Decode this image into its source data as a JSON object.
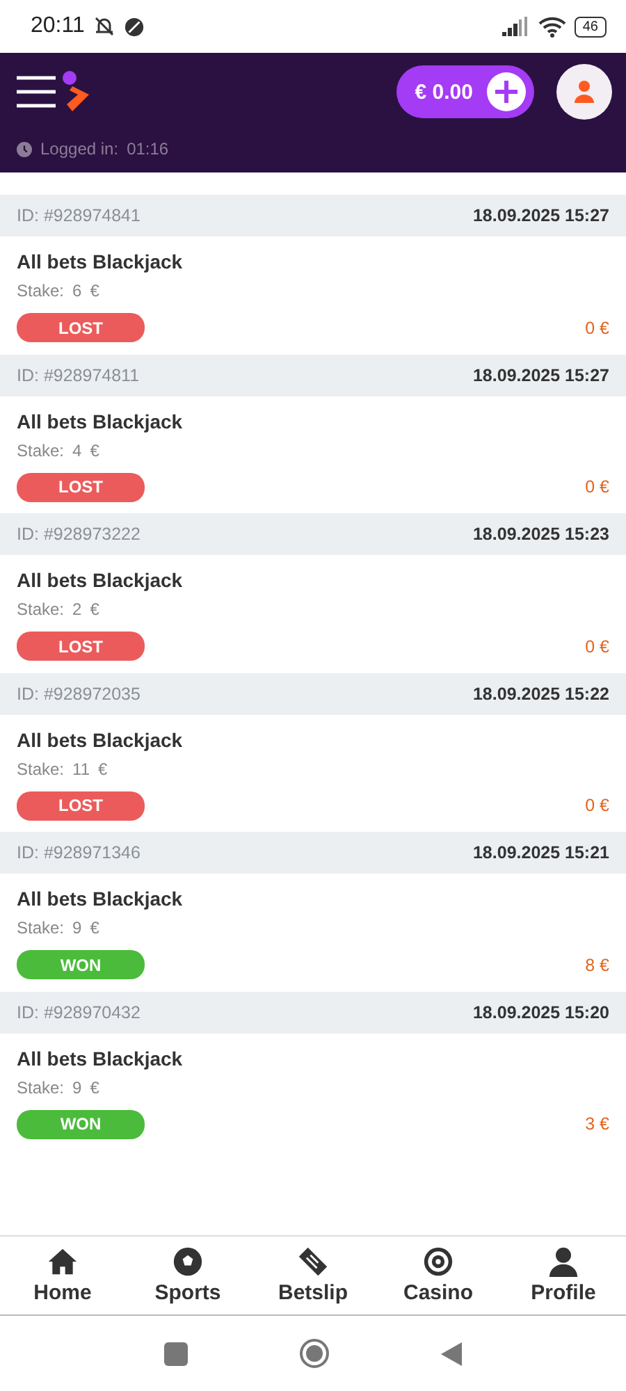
{
  "status_bar": {
    "time": "20:11",
    "battery": "46"
  },
  "header": {
    "balance": "€ 0.00",
    "session_label": "Logged in:",
    "session_time": "01:16"
  },
  "bets": [
    {
      "id": "ID: #928974841",
      "date": "18.09.2025 15:27",
      "title": "All bets Blackjack",
      "stake_label": "Stake:",
      "stake": "6",
      "currency": "€",
      "result": "LOST",
      "kind": "lost",
      "payout": "0 €"
    },
    {
      "id": "ID: #928974811",
      "date": "18.09.2025 15:27",
      "title": "All bets Blackjack",
      "stake_label": "Stake:",
      "stake": "4",
      "currency": "€",
      "result": "LOST",
      "kind": "lost",
      "payout": "0 €"
    },
    {
      "id": "ID: #928973222",
      "date": "18.09.2025 15:23",
      "title": "All bets Blackjack",
      "stake_label": "Stake:",
      "stake": "2",
      "currency": "€",
      "result": "LOST",
      "kind": "lost",
      "payout": "0 €"
    },
    {
      "id": "ID: #928972035",
      "date": "18.09.2025 15:22",
      "title": "All bets Blackjack",
      "stake_label": "Stake:",
      "stake": "11",
      "currency": "€",
      "result": "LOST",
      "kind": "lost",
      "payout": "0 €"
    },
    {
      "id": "ID: #928971346",
      "date": "18.09.2025 15:21",
      "title": "All bets Blackjack",
      "stake_label": "Stake:",
      "stake": "9",
      "currency": "€",
      "result": "WON",
      "kind": "won",
      "payout": "8 €"
    },
    {
      "id": "ID: #928970432",
      "date": "18.09.2025 15:20",
      "title": "All bets Blackjack",
      "stake_label": "Stake:",
      "stake": "9",
      "currency": "€",
      "result": "WON",
      "kind": "won",
      "payout": "3 €"
    }
  ],
  "bottom_nav": [
    {
      "label": "Home",
      "kind": "home"
    },
    {
      "label": "Sports",
      "kind": "sports"
    },
    {
      "label": "Betslip",
      "kind": "betslip"
    },
    {
      "label": "Casino",
      "kind": "casino"
    },
    {
      "label": "Profile",
      "kind": "profile"
    }
  ]
}
